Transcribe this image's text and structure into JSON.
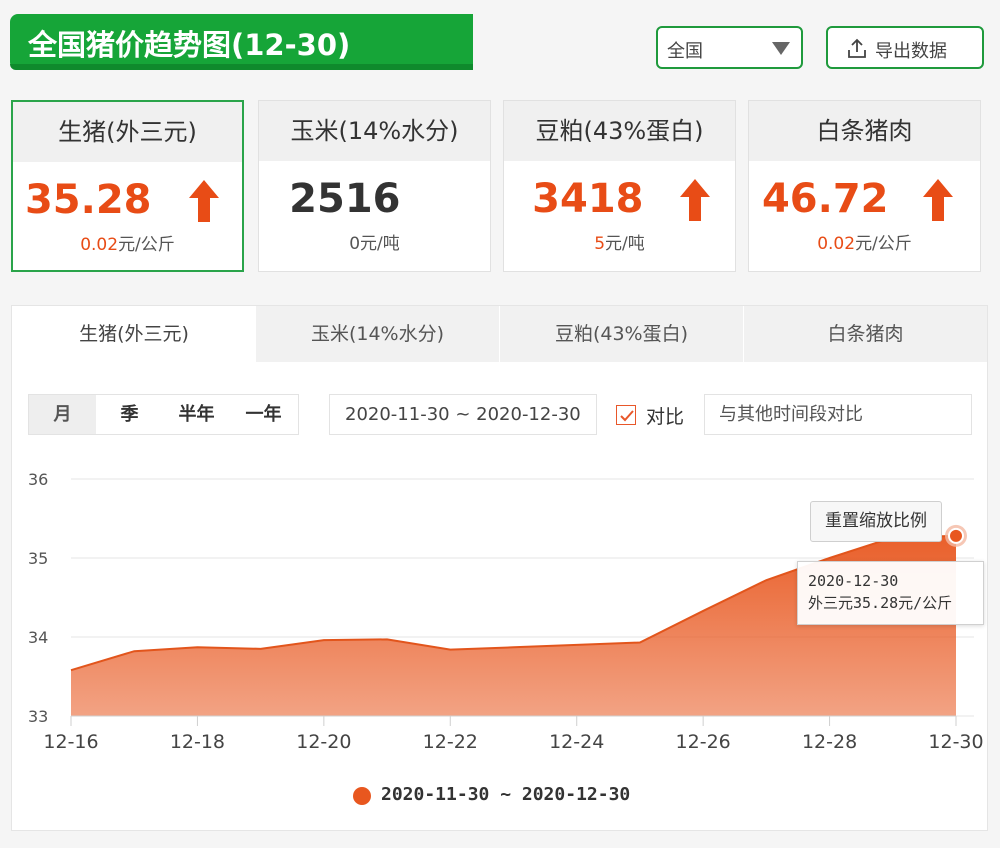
{
  "header": {
    "title": "全国猪价趋势图(12-30)",
    "region_select": {
      "value": "全国"
    },
    "export_label": "导出数据"
  },
  "cards": [
    {
      "name": "生猪(外三元)",
      "price": "35.28",
      "trend": "up",
      "change_amount": "0.02",
      "change_unit": "元/公斤"
    },
    {
      "name": "玉米(14%水分)",
      "price": "2516",
      "trend": "flat",
      "change_amount": "0",
      "change_unit": "元/吨"
    },
    {
      "name": "豆粕(43%蛋白)",
      "price": "3418",
      "trend": "up",
      "change_amount": "5",
      "change_unit": "元/吨"
    },
    {
      "name": "白条猪肉",
      "price": "46.72",
      "trend": "up",
      "change_amount": "0.02",
      "change_unit": "元/公斤"
    }
  ],
  "tabs": [
    "生猪(外三元)",
    "玉米(14%水分)",
    "豆粕(43%蛋白)",
    "白条猪肉"
  ],
  "controls": {
    "periods": [
      "月",
      "季",
      "半年",
      "一年"
    ],
    "selected_period": "月",
    "date_range": "2020-11-30 ~ 2020-12-30",
    "compare_checked": true,
    "compare_label": "对比",
    "compare_placeholder": "与其他时间段对比",
    "reset_zoom": "重置缩放比例"
  },
  "tooltip": {
    "date": "2020-12-30",
    "text": "外三元35.28元/公斤"
  },
  "colors": {
    "brand_green": "#16a538",
    "accent_red": "#e84c16",
    "series_orange": "#e8571f"
  },
  "chart_data": {
    "type": "area",
    "x": [
      "12-16",
      "12-17",
      "12-18",
      "12-19",
      "12-20",
      "12-21",
      "12-22",
      "12-23",
      "12-24",
      "12-25",
      "12-26",
      "12-27",
      "12-28",
      "12-29",
      "12-30"
    ],
    "x_ticks": [
      "12-16",
      "12-18",
      "12-20",
      "12-22",
      "12-24",
      "12-26",
      "12-28",
      "12-30"
    ],
    "series": [
      {
        "name": "2020-11-30 ~ 2020-12-30",
        "values": [
          33.58,
          33.82,
          33.87,
          33.85,
          33.96,
          33.97,
          33.84,
          33.87,
          33.9,
          33.93,
          34.33,
          34.72,
          35.0,
          35.26,
          35.28
        ]
      }
    ],
    "yticks": [
      33,
      34,
      35,
      36
    ],
    "ylim": [
      33,
      36
    ],
    "grid": true,
    "legend": "bottom-center"
  }
}
